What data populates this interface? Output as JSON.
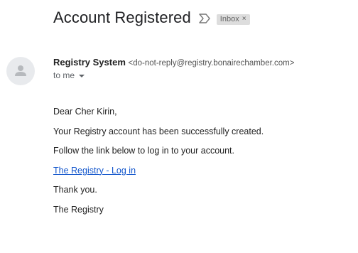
{
  "email": {
    "subject": "Account Registered",
    "label": "Inbox",
    "label_remove": "×",
    "sender_name": "Registry System",
    "sender_email": "<do-not-reply@registry.bonairechamber.com>",
    "recipient": "to me",
    "body": {
      "greeting": "Dear Cher Kirin,",
      "line1": "Your Registry account has been successfully created.",
      "line2": "Follow the link below to log in to your account.",
      "link_text": "The Registry - Log in",
      "thanks": "Thank you.",
      "signature": "The Registry"
    }
  },
  "icons": {
    "importance": "importance-marker-icon",
    "avatar": "person-avatar-icon",
    "caret": "caret-down-icon"
  },
  "colors": {
    "link": "#1155cc",
    "chip_bg": "#dddddd",
    "avatar_bg": "#e8eaed"
  }
}
